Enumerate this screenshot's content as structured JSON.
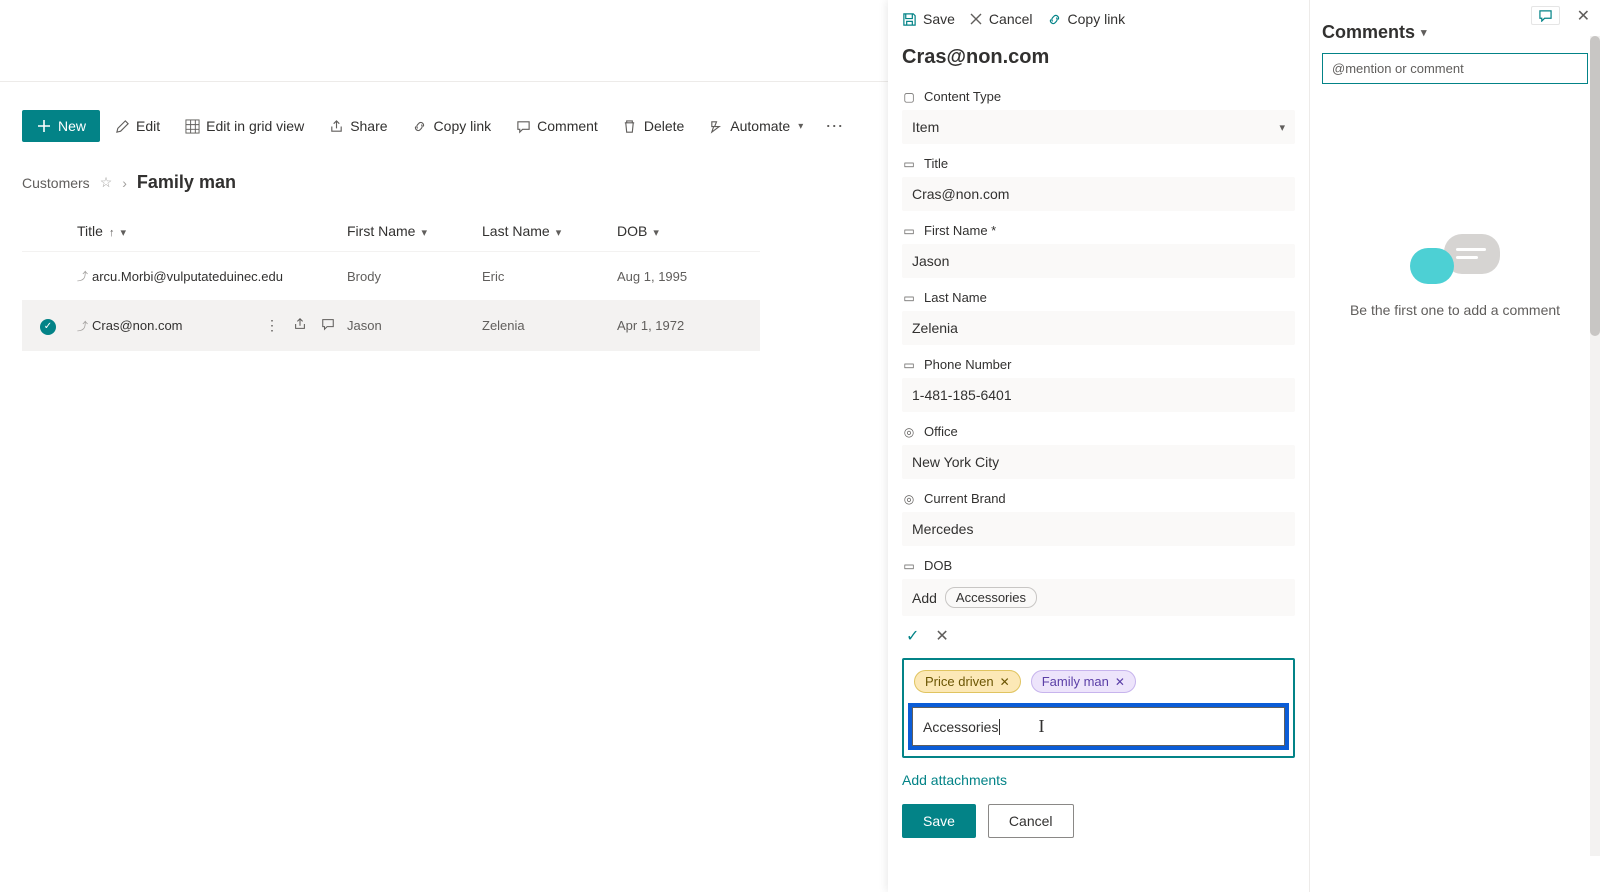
{
  "toolbar": {
    "new": "New",
    "edit": "Edit",
    "grid": "Edit in grid view",
    "share": "Share",
    "copylink": "Copy link",
    "comment": "Comment",
    "delete": "Delete",
    "automate": "Automate"
  },
  "breadcrumb": {
    "list": "Customers",
    "view": "Family man"
  },
  "columns": {
    "title": "Title",
    "firstname": "First Name",
    "lastname": "Last Name",
    "dob": "DOB"
  },
  "rows": [
    {
      "title": "arcu.Morbi@vulputateduinec.edu",
      "fn": "Brody",
      "ln": "Eric",
      "dob": "Aug 1, 1995",
      "selected": false
    },
    {
      "title": "Cras@non.com",
      "fn": "Jason",
      "ln": "Zelenia",
      "dob": "Apr 1, 1972",
      "selected": true
    }
  ],
  "pane": {
    "save": "Save",
    "cancel": "Cancel",
    "copylink": "Copy link",
    "title": "Cras@non.com",
    "fields": {
      "contenttype_label": "Content Type",
      "contenttype_value": "Item",
      "title_label": "Title",
      "title_value": "Cras@non.com",
      "firstname_label": "First Name *",
      "firstname_value": "Jason",
      "lastname_label": "Last Name",
      "lastname_value": "Zelenia",
      "phone_label": "Phone Number",
      "phone_value": "1-481-185-6401",
      "office_label": "Office",
      "office_value": "New York City",
      "brand_label": "Current Brand",
      "brand_value": "Mercedes",
      "dob_label": "DOB"
    },
    "suggest_prefix": "Add",
    "suggest_chip": "Accessories",
    "tags": {
      "t1": "Price driven",
      "t2": "Family man"
    },
    "typed": "Accessories",
    "add_attach": "Add attachments",
    "btn_save": "Save",
    "btn_cancel": "Cancel"
  },
  "comments": {
    "heading": "Comments",
    "placeholder": "@mention or comment",
    "empty": "Be the first one to add a comment"
  }
}
